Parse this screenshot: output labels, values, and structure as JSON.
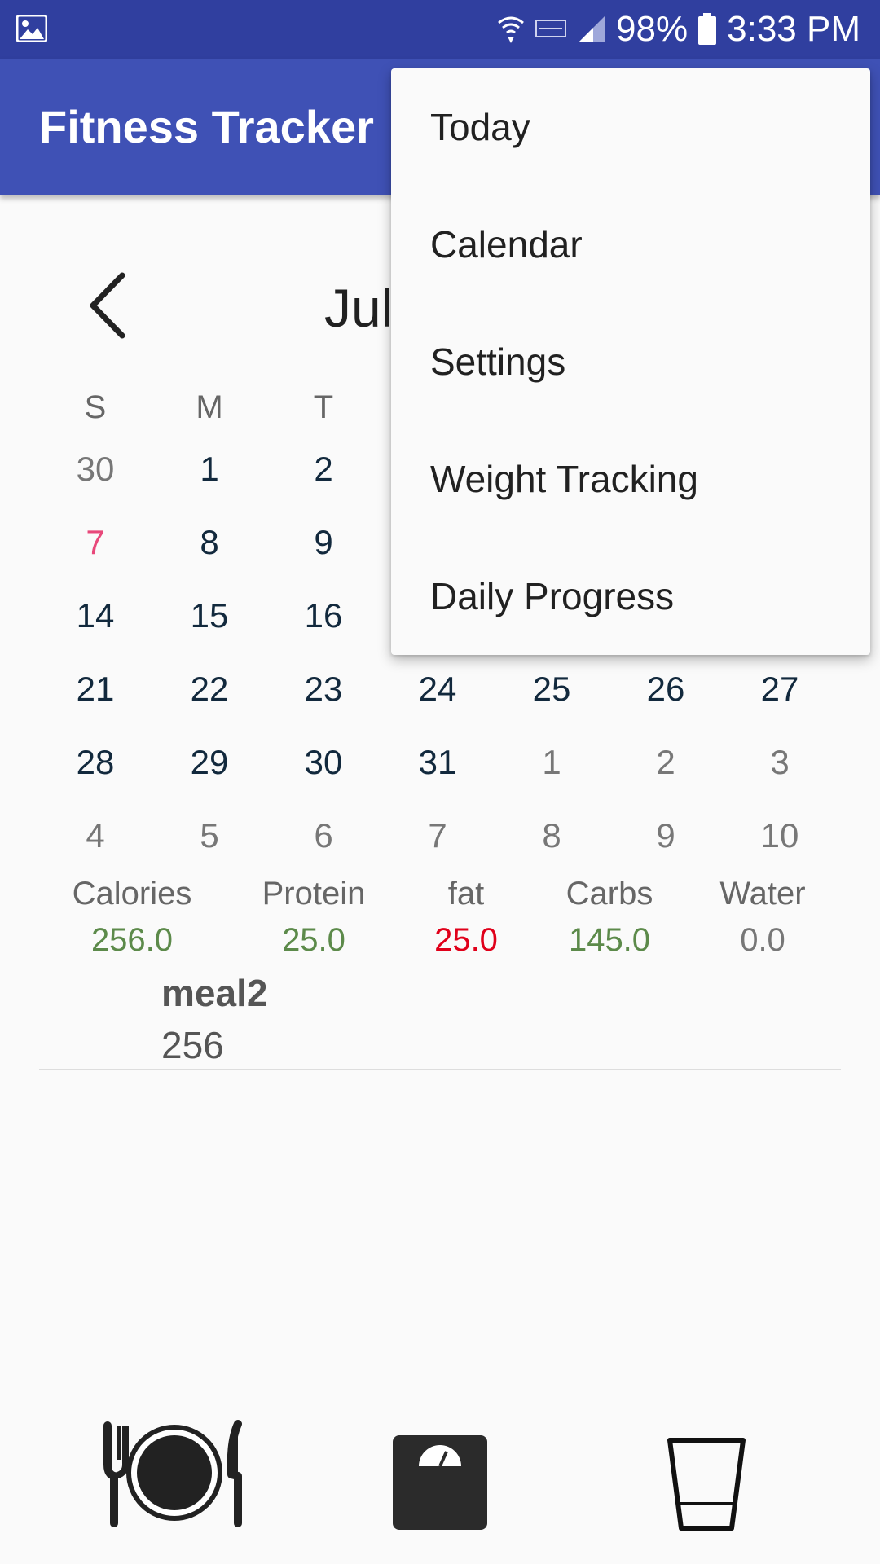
{
  "status_bar": {
    "battery": "98%",
    "time": "3:33 PM",
    "icons": [
      "image-icon",
      "wifi-icon",
      "data-icon",
      "signal-icon",
      "battery-icon"
    ]
  },
  "app_bar": {
    "title": "Fitness Tracker"
  },
  "menu": {
    "items": [
      "Today",
      "Calendar",
      "Settings",
      "Weight Tracking",
      "Daily Progress"
    ]
  },
  "calendar": {
    "month_label": "Jul",
    "weekday_labels": [
      "S",
      "M",
      "T"
    ],
    "rows": [
      [
        "30",
        "1",
        "2"
      ],
      [
        "7",
        "8",
        "9"
      ],
      [
        "14",
        "15",
        "16"
      ],
      [
        "21",
        "22",
        "23",
        "24",
        "25",
        "26",
        "27"
      ],
      [
        "28",
        "29",
        "30",
        "31",
        "1",
        "2",
        "3"
      ],
      [
        "4",
        "5",
        "6",
        "7",
        "8",
        "9",
        "10"
      ]
    ]
  },
  "summary": {
    "calories": {
      "label": "Calories",
      "value": "256.0"
    },
    "protein": {
      "label": "Protein",
      "value": "25.0"
    },
    "fat": {
      "label": "fat",
      "value": "25.0"
    },
    "carbs": {
      "label": "Carbs",
      "value": "145.0"
    },
    "water": {
      "label": "Water",
      "value": "0.0"
    }
  },
  "meal": {
    "name": "meal2",
    "calories": "256"
  },
  "bottom_nav": {
    "icons": [
      "food-icon",
      "scale-icon",
      "water-glass-icon"
    ]
  },
  "colors": {
    "status_bar": "#303f9f",
    "app_bar": "#3f51b5",
    "today": "#e8487a",
    "good": "#5c8a4a",
    "over": "#e0001a",
    "neutral": "#777777"
  }
}
